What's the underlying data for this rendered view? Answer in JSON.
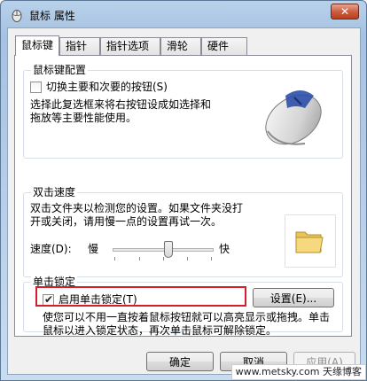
{
  "window": {
    "title": "鼠标 属性",
    "close_label": "✕"
  },
  "tabs": [
    {
      "label": "鼠标键",
      "active": true
    },
    {
      "label": "指针",
      "active": false
    },
    {
      "label": "指针选项",
      "active": false
    },
    {
      "label": "滑轮",
      "active": false
    },
    {
      "label": "硬件",
      "active": false
    }
  ],
  "button_config": {
    "title": "鼠标键配置",
    "checkbox_label": "切换主要和次要的按钮(S)",
    "checkbox_checked": false,
    "description": "选择此复选框来将右按钮设成如选择和拖放等主要性能使用。"
  },
  "double_click": {
    "title": "双击速度",
    "description": "双击文件夹以检测您的设置。如果文件夹没打开或关闭，请用慢一点的设置再试一次。",
    "speed_label": "速度(D):",
    "slow_label": "慢",
    "fast_label": "快",
    "speed_level": 0.55
  },
  "click_lock": {
    "title": "单击锁定",
    "checkbox_label": "启用单击锁定(T)",
    "checkbox_checked": true,
    "settings_button": "设置(E)...",
    "description": "使您可以不用一直按着鼠标按钮就可以高亮显示或拖拽。单击鼠标以进入锁定状态，再次单击鼠标可解除锁定。"
  },
  "footer": {
    "ok": "确定",
    "cancel": "取消",
    "apply": "应用(A)"
  },
  "watermark": "www.metsky.com  天缘博客",
  "colors": {
    "highlight": "#d21f2b",
    "title_bar": "#b9d1ea",
    "close_button": "#c95a3c"
  }
}
